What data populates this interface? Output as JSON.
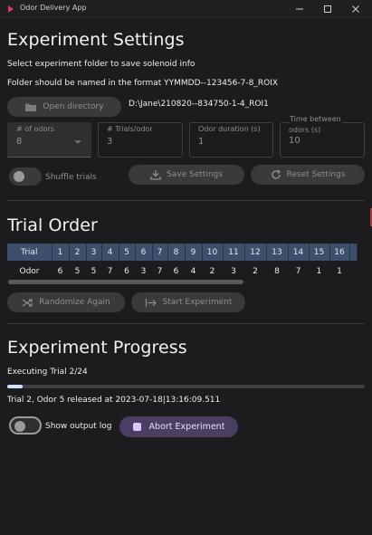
{
  "window": {
    "title": "Odor Delivery App",
    "icon": "app-logo-icon",
    "accent": "#e0386b"
  },
  "settings": {
    "heading": "Experiment Settings",
    "instruction_select": "Select experiment folder to save solenoid info",
    "instruction_format": "Folder should be named in the format YYMMDD--123456-7-8_ROIX",
    "open_directory_label": "Open directory",
    "directory_path": "D:\\Jane\\210820--834750-1-4_ROI1",
    "fields": {
      "odors": {
        "label": "# of odors",
        "value": "8"
      },
      "trials": {
        "label": "# Trials/odor",
        "value": "3"
      },
      "duration": {
        "label": "Odor duration (s)",
        "value": "1"
      },
      "between": {
        "label_1": "Time between",
        "label_2": "odors (s)",
        "value": "10"
      }
    },
    "shuffle_label": "Shuffle trials",
    "save_label": "Save Settings",
    "reset_label": "Reset Settings"
  },
  "trial_order": {
    "heading": "Trial Order",
    "row_labels": {
      "trial": "Trial",
      "odor": "Odor"
    },
    "trials": [
      "1",
      "2",
      "3",
      "4",
      "5",
      "6",
      "7",
      "8",
      "9",
      "10",
      "11",
      "12",
      "13",
      "14",
      "15",
      "16"
    ],
    "odors": [
      "6",
      "5",
      "5",
      "7",
      "6",
      "3",
      "7",
      "6",
      "4",
      "2",
      "3",
      "2",
      "8",
      "7",
      "1",
      "1"
    ],
    "randomize_label": "Randomize Again",
    "start_label": "Start Experiment"
  },
  "progress": {
    "heading": "Experiment Progress",
    "status": "Executing Trial 2/24",
    "fraction": 0.042,
    "log_line": "Trial 2, Odor 5 released at 2023-07-18|13:16:09.511",
    "show_log_label": "Show output log",
    "abort_label": "Abort Experiment"
  }
}
